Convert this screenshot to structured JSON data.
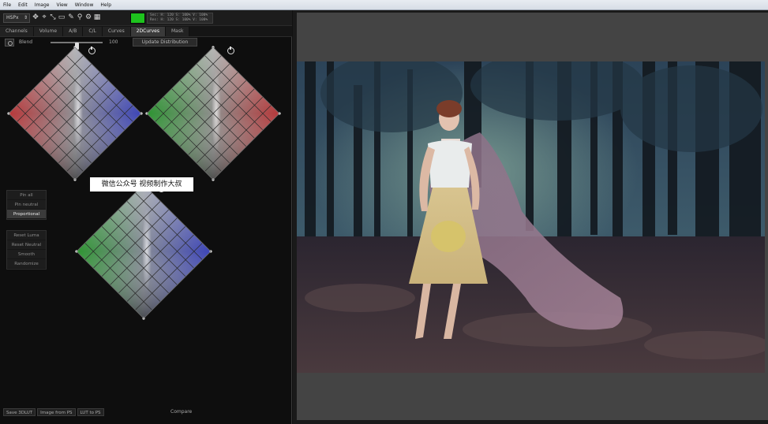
{
  "menubar": {
    "items": [
      "File",
      "Edit",
      "Image",
      "View",
      "Window",
      "Help"
    ]
  },
  "toolbar": {
    "mode": "HSPx",
    "readout": {
      "line1": "Sec: H: 120  S: 100% V: 100%",
      "line2": "Res: H: 120  S: 100% V: 100%"
    },
    "swatch_color": "#1ec31e",
    "icons": [
      "move-icon",
      "crosshair-icon",
      "resize-icon",
      "select-icon",
      "eyedropper-icon",
      "zoom-icon",
      "settings-icon",
      "grid-icon"
    ]
  },
  "tabs": [
    {
      "label": "Channels",
      "active": false
    },
    {
      "label": "Volume",
      "active": false
    },
    {
      "label": "A/B",
      "active": false
    },
    {
      "label": "C/L",
      "active": false
    },
    {
      "label": "Curves",
      "active": false
    },
    {
      "label": "2DCurves",
      "active": true
    },
    {
      "label": "Mask",
      "active": false
    }
  ],
  "blend": {
    "label": "Blend",
    "value": "100",
    "slider_fraction": 0.5,
    "update_label": "Update Distribution"
  },
  "side_buttons": {
    "group1": [
      {
        "label": "Pin all",
        "active": false
      },
      {
        "label": "Pin neutral",
        "active": false
      },
      {
        "label": "Proportional",
        "active": true
      }
    ],
    "group2": [
      {
        "label": "Reset Luma",
        "active": false
      },
      {
        "label": "Reset Neutral",
        "active": false
      },
      {
        "label": "Smooth",
        "active": false
      },
      {
        "label": "Randomize",
        "active": false
      }
    ]
  },
  "watermark": "微信公众号 视频制作大叔",
  "bottom": {
    "buttons": [
      "Save 3DLUT",
      "Image from PS",
      "LUT to PS"
    ],
    "compare": "Compare"
  },
  "colors": {
    "red": "#c23a3a",
    "green": "#2f9a34",
    "blue": "#3f48c2",
    "swatch": "#1ec31e"
  }
}
